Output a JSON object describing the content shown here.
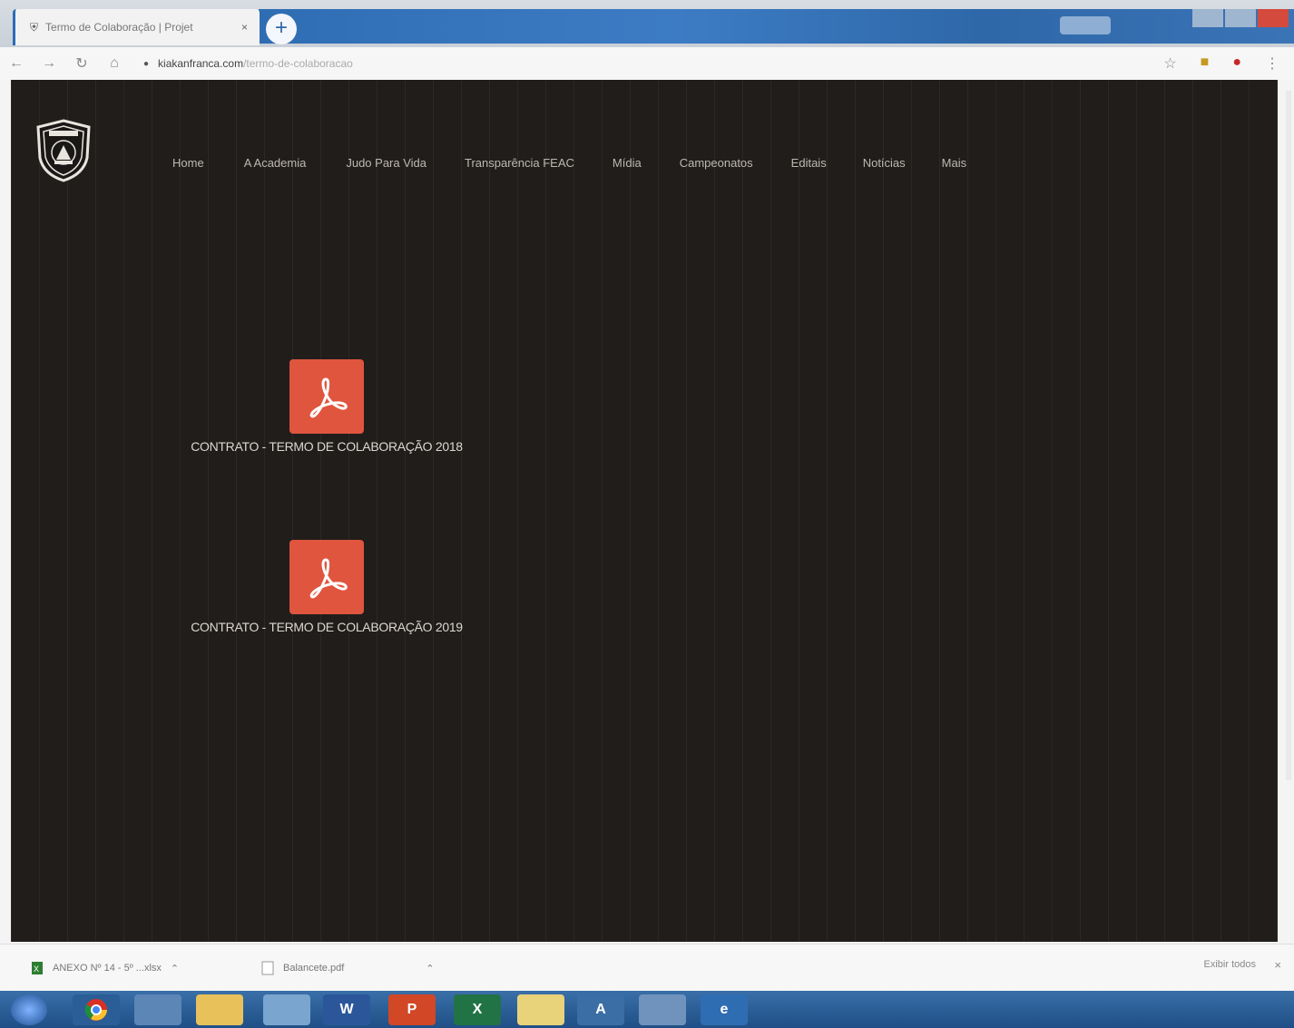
{
  "browser": {
    "tab_title": "Termo de Colaboração | Projet",
    "tab_close": "×",
    "new_tab": "+",
    "url_domain": "kiakanfranca.com",
    "url_path": "/termo-de-colaboracao"
  },
  "nav": {
    "items": [
      "Home",
      "A Academia",
      "Judo Para Vida",
      "Transparência FEAC",
      "Mídia",
      "Campeonatos",
      "Editais",
      "Notícias",
      "Mais"
    ]
  },
  "documents": [
    {
      "label": "CONTRATO - TERMO DE COLABORAÇÃO 2018"
    },
    {
      "label": "CONTRATO - TERMO DE COLABORAÇÃO 2019"
    }
  ],
  "downloads": {
    "items": [
      {
        "name": "ANEXO Nº 14 - 5º ...xlsx"
      },
      {
        "name": "Balancete.pdf"
      }
    ],
    "show_all": "Exibir todos",
    "close": "×"
  },
  "colors": {
    "page_bg": "#201d1b",
    "pdf_icon": "#e0553e",
    "browser_accent": "#2e68a9"
  },
  "icons": {
    "logo": "academy-shield-logo",
    "pdf": "acrobat-pdf-icon"
  }
}
